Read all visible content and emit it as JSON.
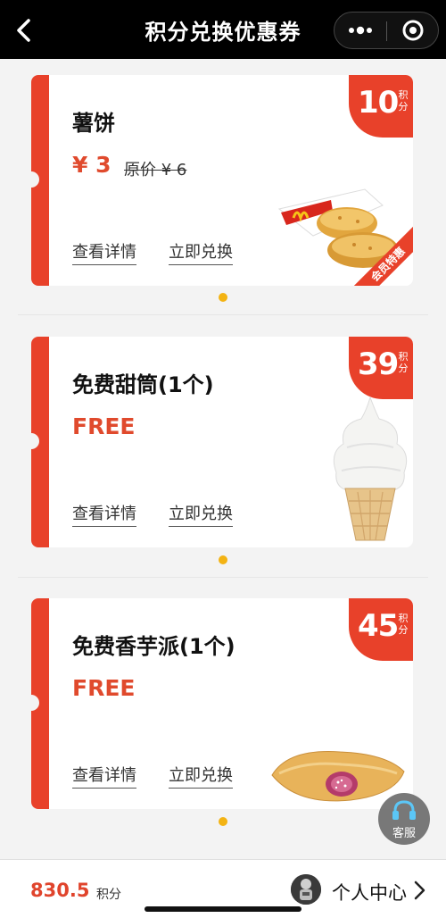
{
  "header": {
    "title": "积分兑换优惠券"
  },
  "coupons": [
    {
      "name": "薯饼",
      "price": "¥ 3",
      "original_price": "原价 ¥ 6",
      "points": "10",
      "points_unit": "积分",
      "ribbon": "会员特惠",
      "detail_label": "查看详情",
      "redeem_label": "立即兑换"
    },
    {
      "name": "免费甜筒(1个)",
      "price": "FREE",
      "points": "39",
      "points_unit": "积分",
      "detail_label": "查看详情",
      "redeem_label": "立即兑换"
    },
    {
      "name": "免费香芋派(1个)",
      "price": "FREE",
      "points": "45",
      "points_unit": "积分",
      "detail_label": "查看详情",
      "redeem_label": "立即兑换"
    }
  ],
  "service_button": {
    "label": "客服"
  },
  "footer": {
    "points_value": "830.5",
    "points_unit": "积分",
    "profile_label": "个人中心"
  },
  "colors": {
    "accent_red": "#e8412a",
    "dot_yellow": "#f3b313",
    "header_bg": "#000000"
  }
}
